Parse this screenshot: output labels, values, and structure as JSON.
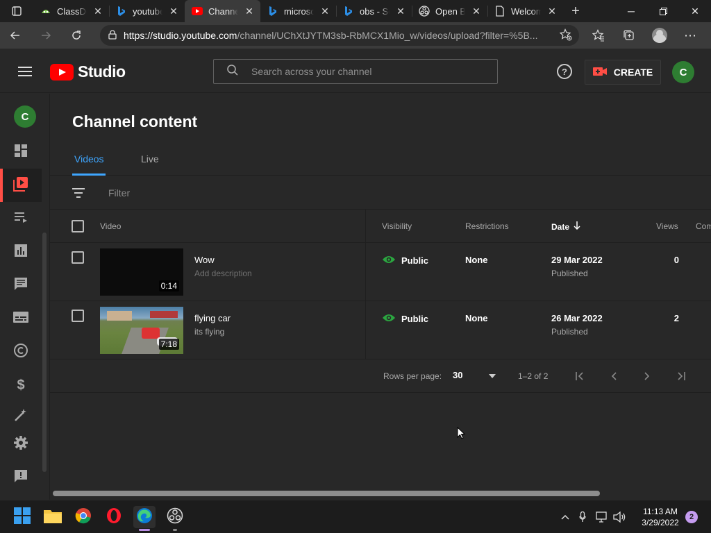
{
  "browser": {
    "tabs": [
      {
        "title": "ClassDojo",
        "icon": "classdojo-icon"
      },
      {
        "title": "youtube",
        "icon": "bing-icon"
      },
      {
        "title": "Channel",
        "icon": "youtube-icon",
        "active": true
      },
      {
        "title": "microsoft",
        "icon": "bing-icon"
      },
      {
        "title": "obs - Se",
        "icon": "bing-icon"
      },
      {
        "title": "Open Br",
        "icon": "obs-icon"
      },
      {
        "title": "Welcom",
        "icon": "page-icon"
      }
    ],
    "url_host": "https://studio.youtube.com",
    "url_path": "/channel/UChXtJYTM3sb-RbMCX1Mio_w/videos/upload?filter=%5B..."
  },
  "studio": {
    "logo_text": "Studio",
    "search_placeholder": "Search across your channel",
    "create_label": "CREATE",
    "avatar_letter": "C"
  },
  "sidebar": {
    "avatar_letter": "C",
    "items": [
      "dashboard-icon",
      "content-icon",
      "playlists-icon",
      "analytics-icon",
      "comments-icon",
      "subtitles-icon",
      "copyright-icon",
      "earn-icon",
      "customization-icon",
      "settings-icon",
      "feedback-icon"
    ]
  },
  "main": {
    "title": "Channel content",
    "tabs": [
      "Videos",
      "Live"
    ],
    "filter_placeholder": "Filter",
    "columns": {
      "video": "Video",
      "visibility": "Visibility",
      "restrictions": "Restrictions",
      "date": "Date",
      "views": "Views",
      "comments": "Com"
    },
    "rows": [
      {
        "title": "Wow",
        "description": "Add description",
        "duration": "0:14",
        "visibility": "Public",
        "restrictions": "None",
        "date": "29 Mar 2022",
        "status": "Published",
        "views": "0"
      },
      {
        "title": "flying car",
        "description": "its flying",
        "duration": "7:18",
        "visibility": "Public",
        "restrictions": "None",
        "date": "26 Mar 2022",
        "status": "Published",
        "views": "2"
      }
    ],
    "pager": {
      "rows_label": "Rows per page:",
      "rows_value": "30",
      "range": "1–2 of 2"
    }
  },
  "taskbar": {
    "time": "11:13 AM",
    "date": "3/29/2022",
    "notifications": "2"
  },
  "colors": {
    "accent_blue": "#3ea6ff",
    "youtube_red": "#ff0000",
    "public_green": "#2ba640"
  }
}
